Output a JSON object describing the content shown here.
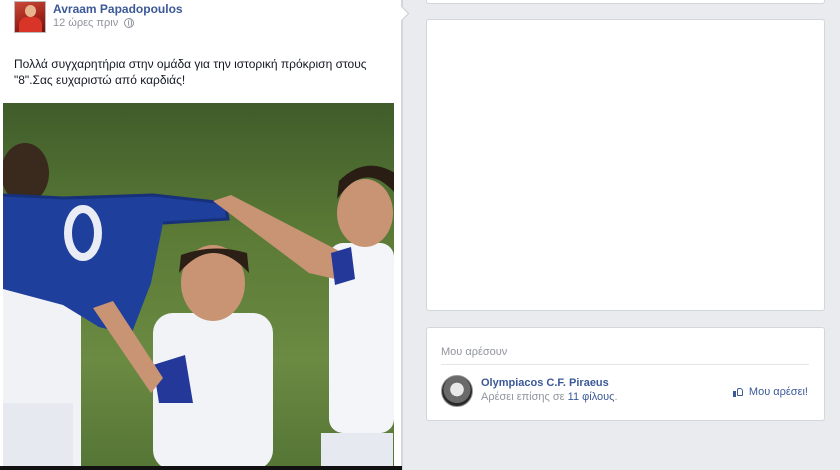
{
  "post": {
    "author": "Avraam Papadopoulos",
    "time": "12 ώρες πριν",
    "text_line1": "Πολλά συγχαρητήρια στην ομάδα για την ιστορική πρόκριση στους",
    "text_line2": "\"8\".Σας ευχαριστώ από καρδιάς!",
    "photo_icon": "photo",
    "privacy_icon": "globe-icon"
  },
  "sidebar": {
    "likes_title": "Μου αρέσουν",
    "page_name": "Olympiacos C.F. Piraeus",
    "page_sub_prefix": "Αρέσει επίσης σε ",
    "page_sub_friends": "11 φίλους",
    "page_sub_suffix": ".",
    "like_button": "Μου αρέσει!"
  },
  "colors": {
    "link": "#3b5998",
    "background": "#e9ebee",
    "muted": "#90949c"
  }
}
